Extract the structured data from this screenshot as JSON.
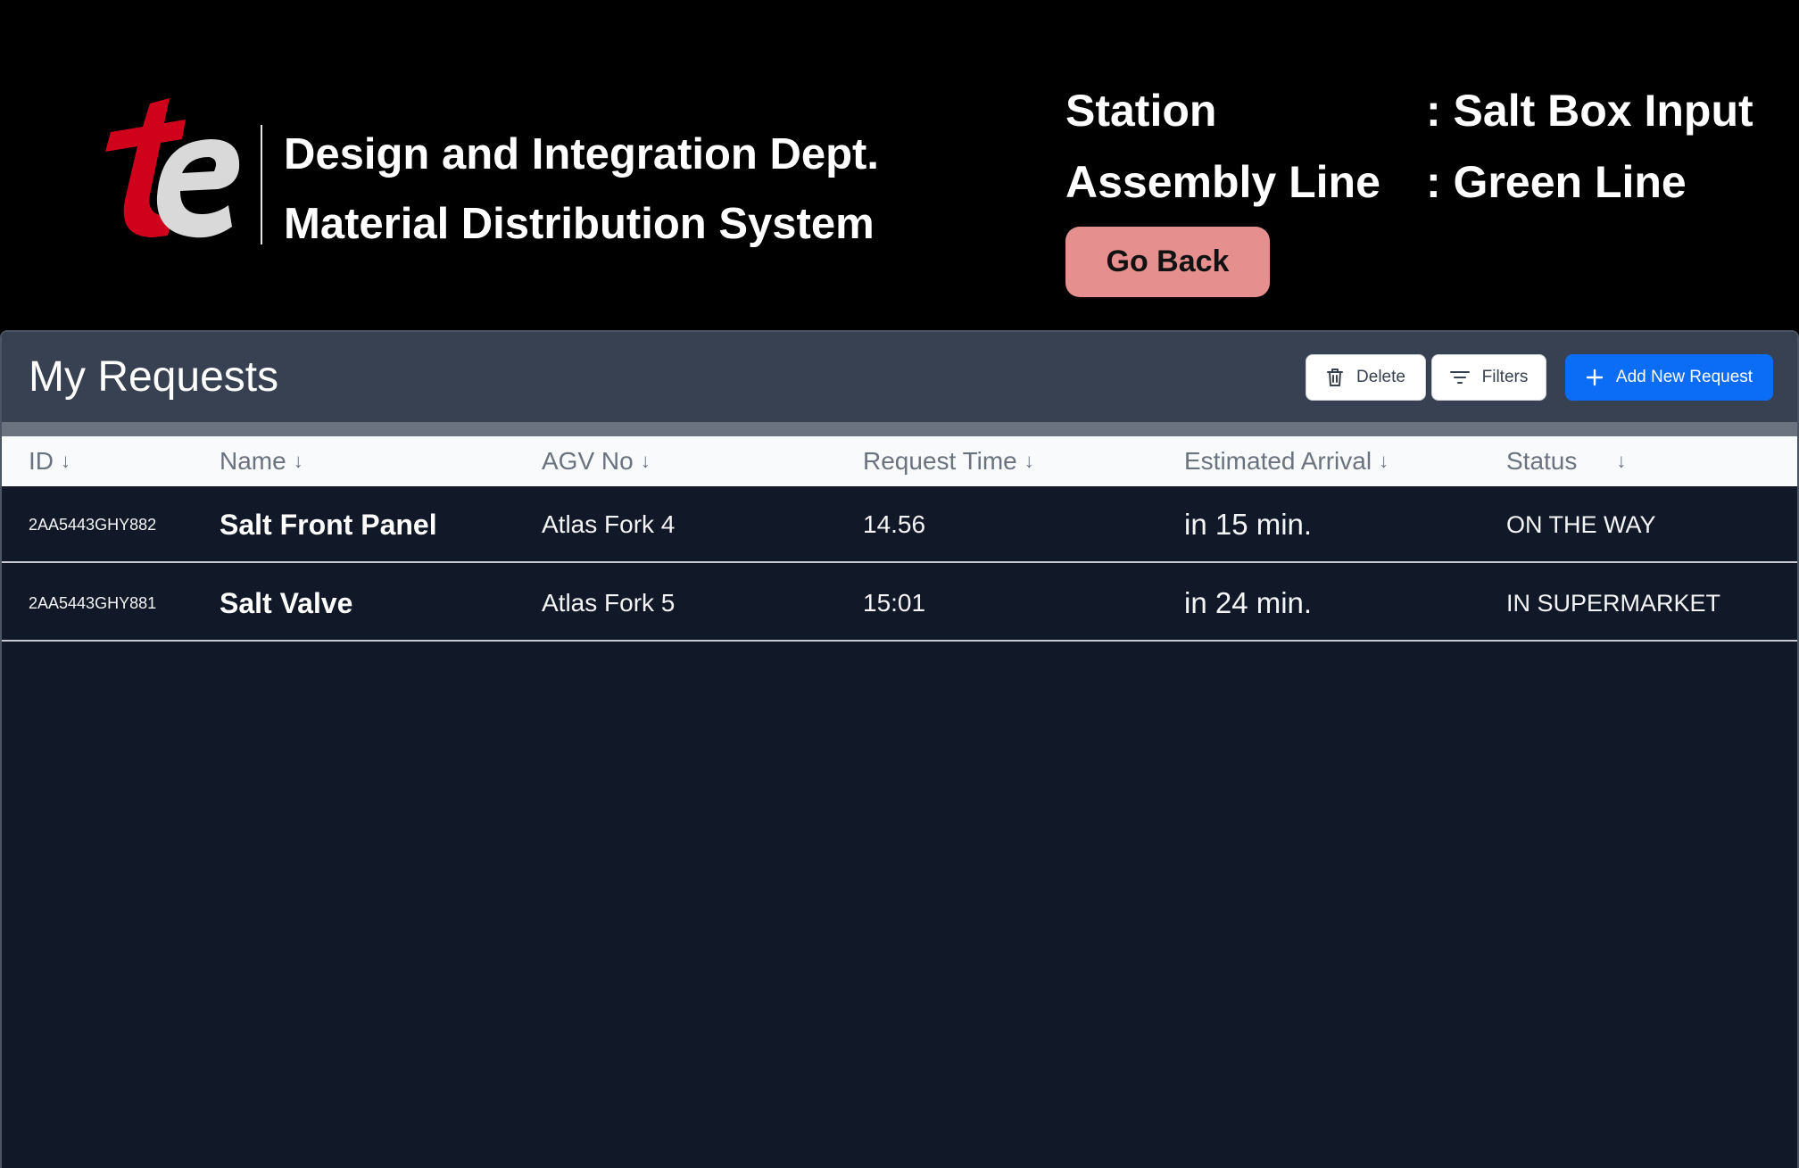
{
  "header": {
    "dept_title": "Design and Integration Dept.",
    "system_title": "Material Distribution System",
    "station_label": "Station",
    "station_value": ": Salt Box Input",
    "line_label": "Assembly Line",
    "line_value": ": Green Line",
    "go_back_label": "Go Back"
  },
  "logo": {
    "text": "te",
    "colors": {
      "t": "#d0021b",
      "e": "#d9d9d9"
    }
  },
  "panel": {
    "title": "My Requests",
    "delete_label": "Delete",
    "filters_label": "Filters",
    "add_label": "Add New Request"
  },
  "table": {
    "columns": [
      {
        "label": "ID",
        "sort": "↓"
      },
      {
        "label": "Name",
        "sort": "↓"
      },
      {
        "label": "AGV No",
        "sort": "↓"
      },
      {
        "label": "Request Time",
        "sort": "↓"
      },
      {
        "label": "Estimated Arrival",
        "sort": "↓"
      },
      {
        "label": "Status",
        "sort": "↓"
      }
    ],
    "rows": [
      {
        "id": "2AA5443GHY882",
        "name": "Salt Front Panel",
        "agv": "Atlas Fork 4",
        "time": "14.56",
        "eta": "in 15 min.",
        "status": "ON THE WAY"
      },
      {
        "id": "2AA5443GHY881",
        "name": "Salt Valve",
        "agv": "Atlas Fork 5",
        "time": "15:01",
        "eta": "in 24 min.",
        "status": "IN SUPERMARKET"
      }
    ]
  },
  "colors": {
    "background": "#000000",
    "panel_bg": "#111827",
    "panel_header": "#374151",
    "go_back": "#e58f8f",
    "primary": "#0b6cf5"
  }
}
